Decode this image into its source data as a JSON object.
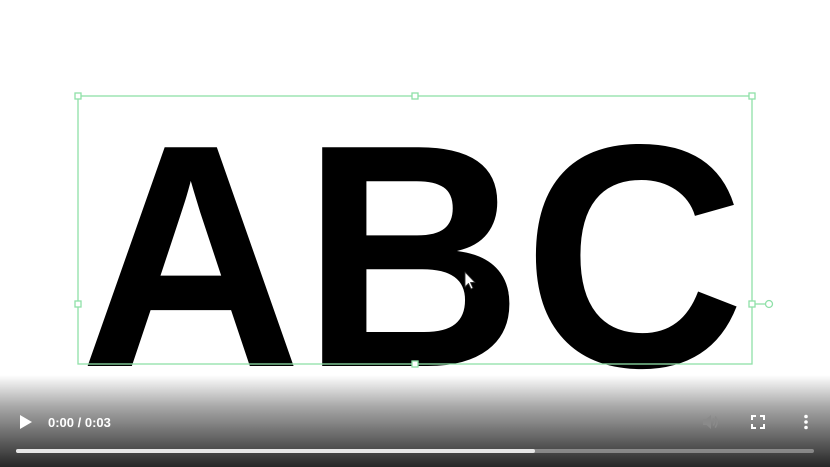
{
  "canvas": {
    "text": "ABC",
    "text_color": "#000000",
    "selection_color": "#8fe0a8"
  },
  "player": {
    "current_time": "0:00",
    "separator": " / ",
    "duration": "0:03",
    "progress_fraction": 0.65,
    "play_icon": "play-icon",
    "mute_icon": "volume-icon",
    "fullscreen_icon": "fullscreen-icon",
    "more_icon": "more-options-icon",
    "muted": true
  }
}
